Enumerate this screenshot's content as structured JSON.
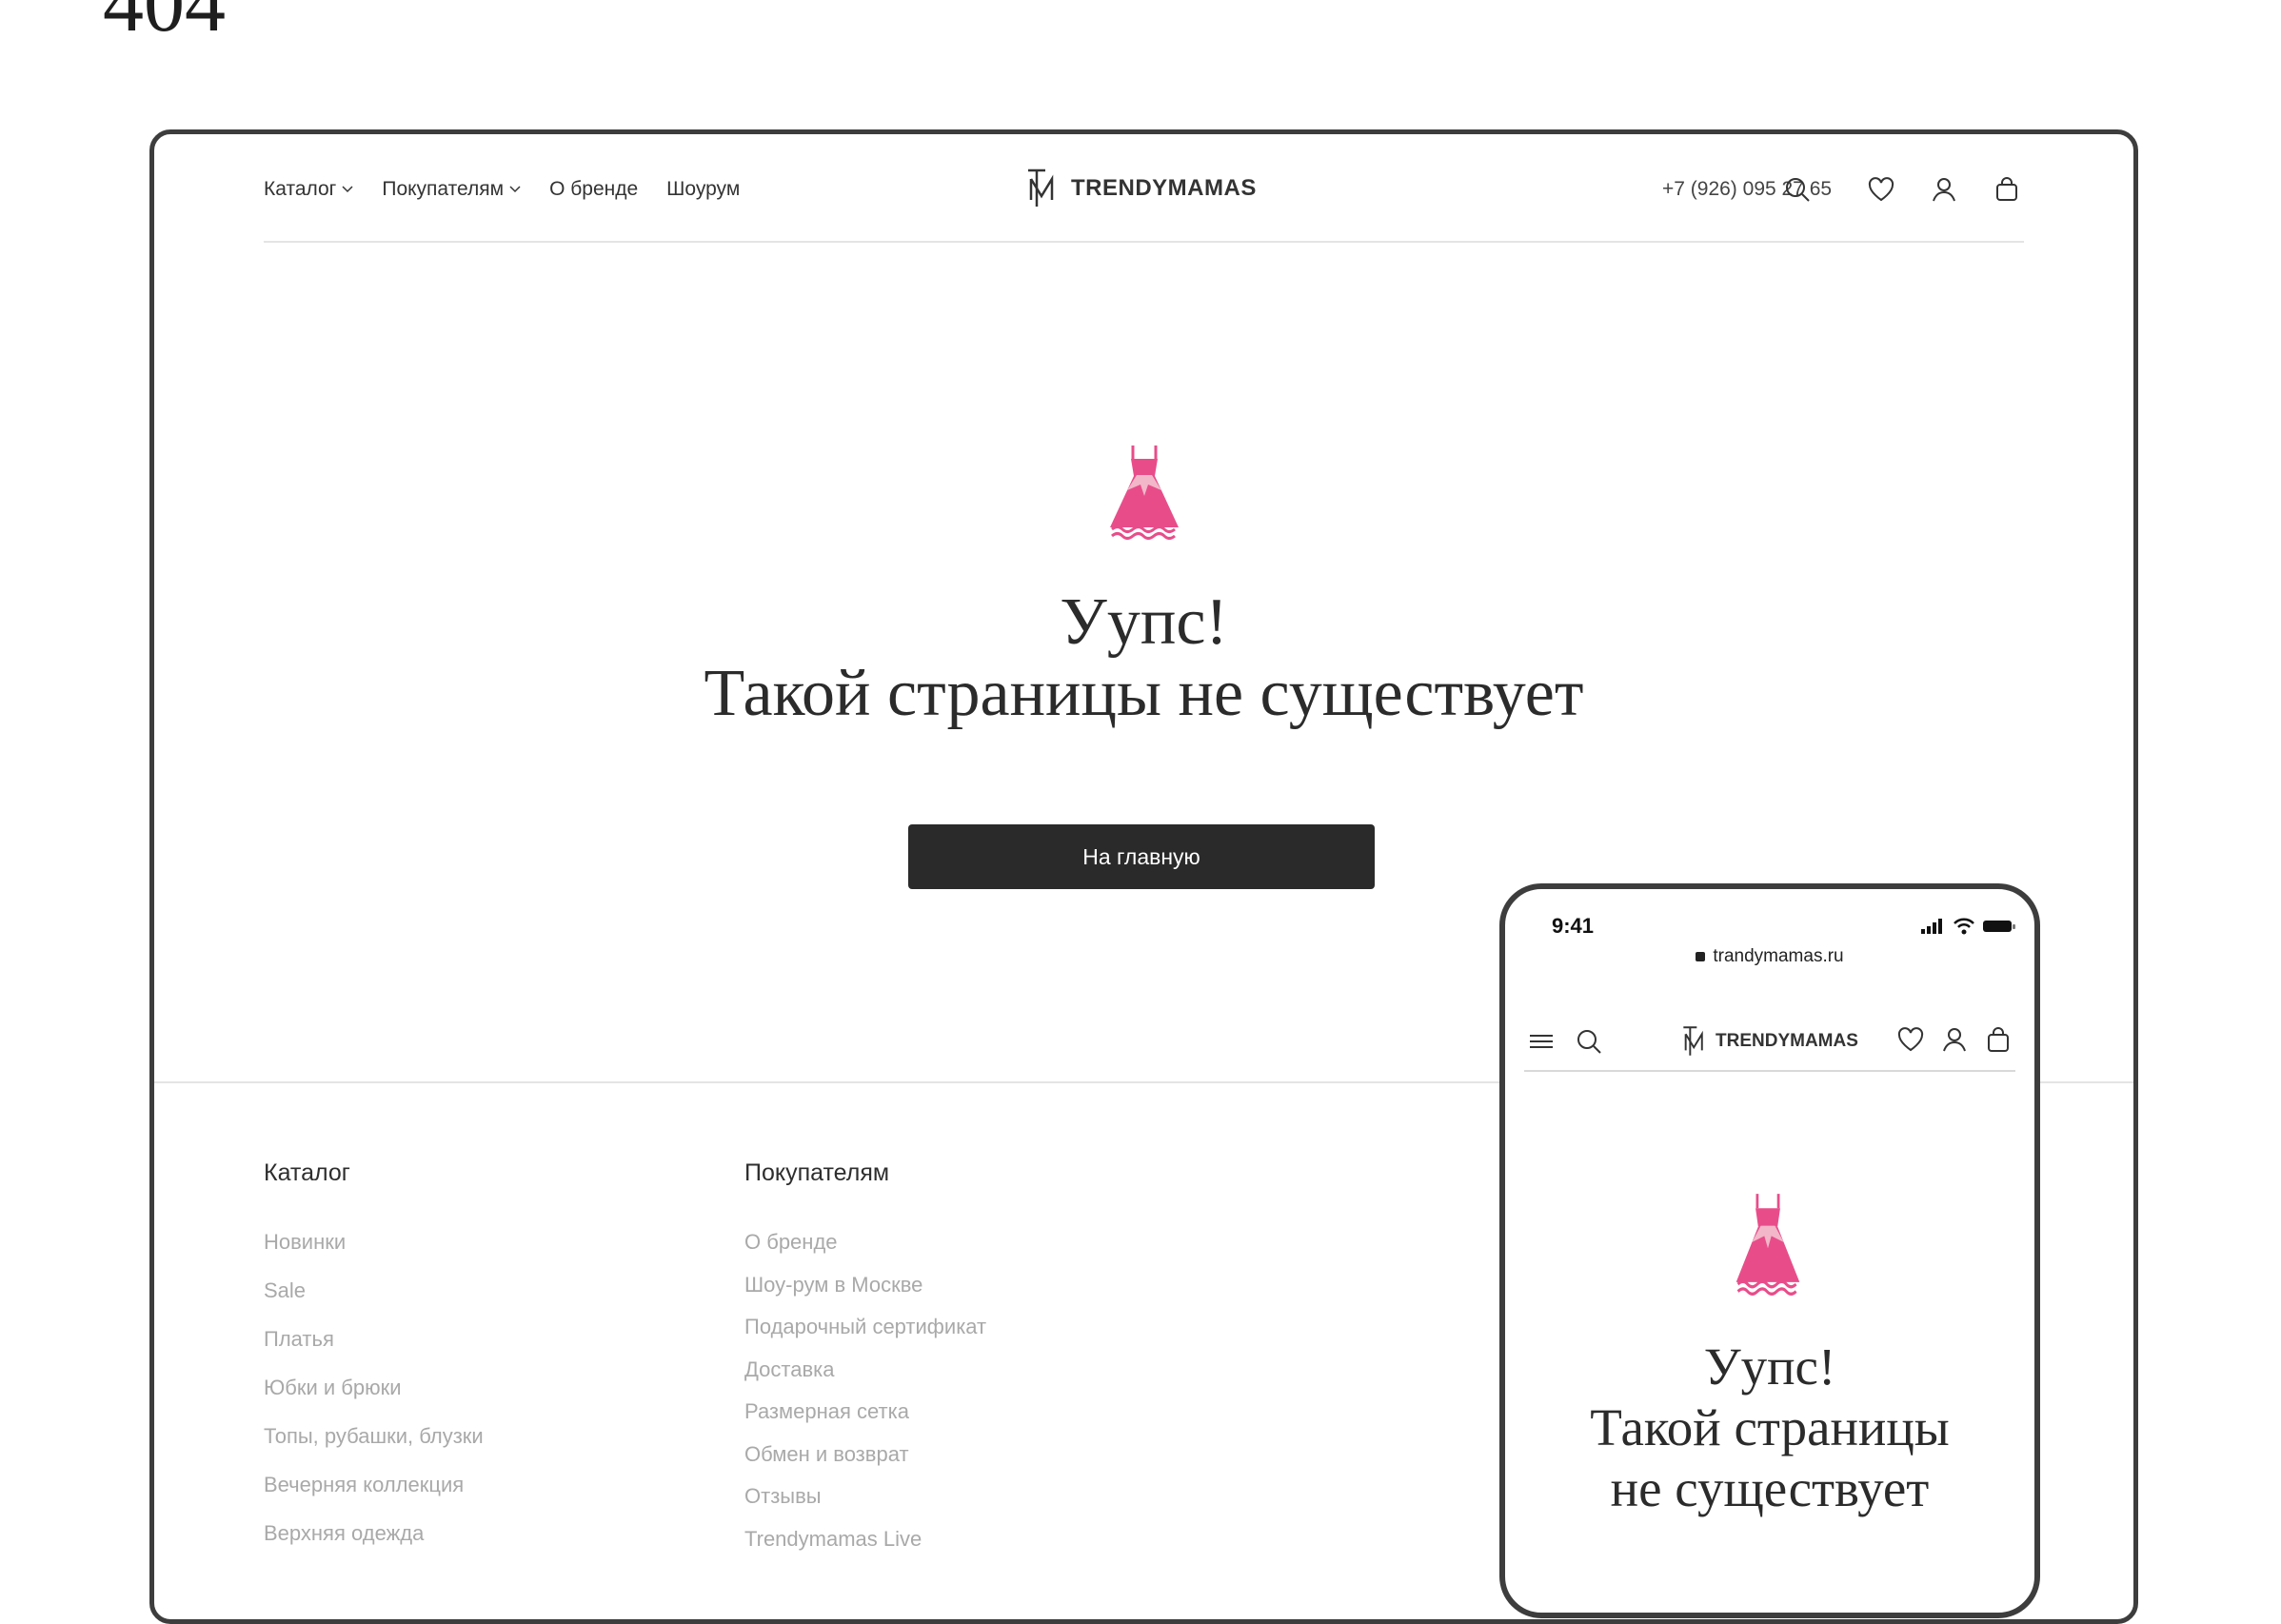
{
  "page_heading": "404",
  "desktop": {
    "nav": [
      {
        "label": "Каталог",
        "has_dropdown": true
      },
      {
        "label": "Покупателям",
        "has_dropdown": true
      },
      {
        "label": "О бренде",
        "has_dropdown": false
      },
      {
        "label": "Шоурум",
        "has_dropdown": false
      }
    ],
    "logo_text": "TRENDYMAMAS",
    "phone": "+7 (926) 095 27 65",
    "icons": [
      "search-icon",
      "heart-icon",
      "user-icon",
      "bag-icon"
    ],
    "title_line1": "Уупс!",
    "title_line2": "Такой страницы не существует",
    "home_button": "На главную",
    "footer": {
      "catalog": {
        "heading": "Каталог",
        "items": [
          "Новинки",
          "Sale",
          "Платья",
          "Юбки и брюки",
          "Топы, рубашки, блузки",
          "Вечерняя коллекция",
          "Верхняя одежда"
        ]
      },
      "buyers": {
        "heading": "Покупателям",
        "items": [
          "О бренде",
          "Шоу-рум в Москве",
          "Подарочный сертификат",
          "Доставка",
          "Размерная сетка",
          "Обмен и возврат",
          "Отзывы",
          "Trendymamas Live"
        ]
      }
    }
  },
  "mobile": {
    "time": "9:41",
    "url": "trandymamas.ru",
    "logo_text": "TRENDYMAMAS",
    "title_line1": "Уупс!",
    "title_line2": "Такой страницы",
    "title_line3": "не существует"
  },
  "colors": {
    "accent_pink": "#e84d8a",
    "button_dark": "#2a2a2a",
    "footer_link": "#a9a9a9",
    "frame": "#3d3d3d"
  }
}
